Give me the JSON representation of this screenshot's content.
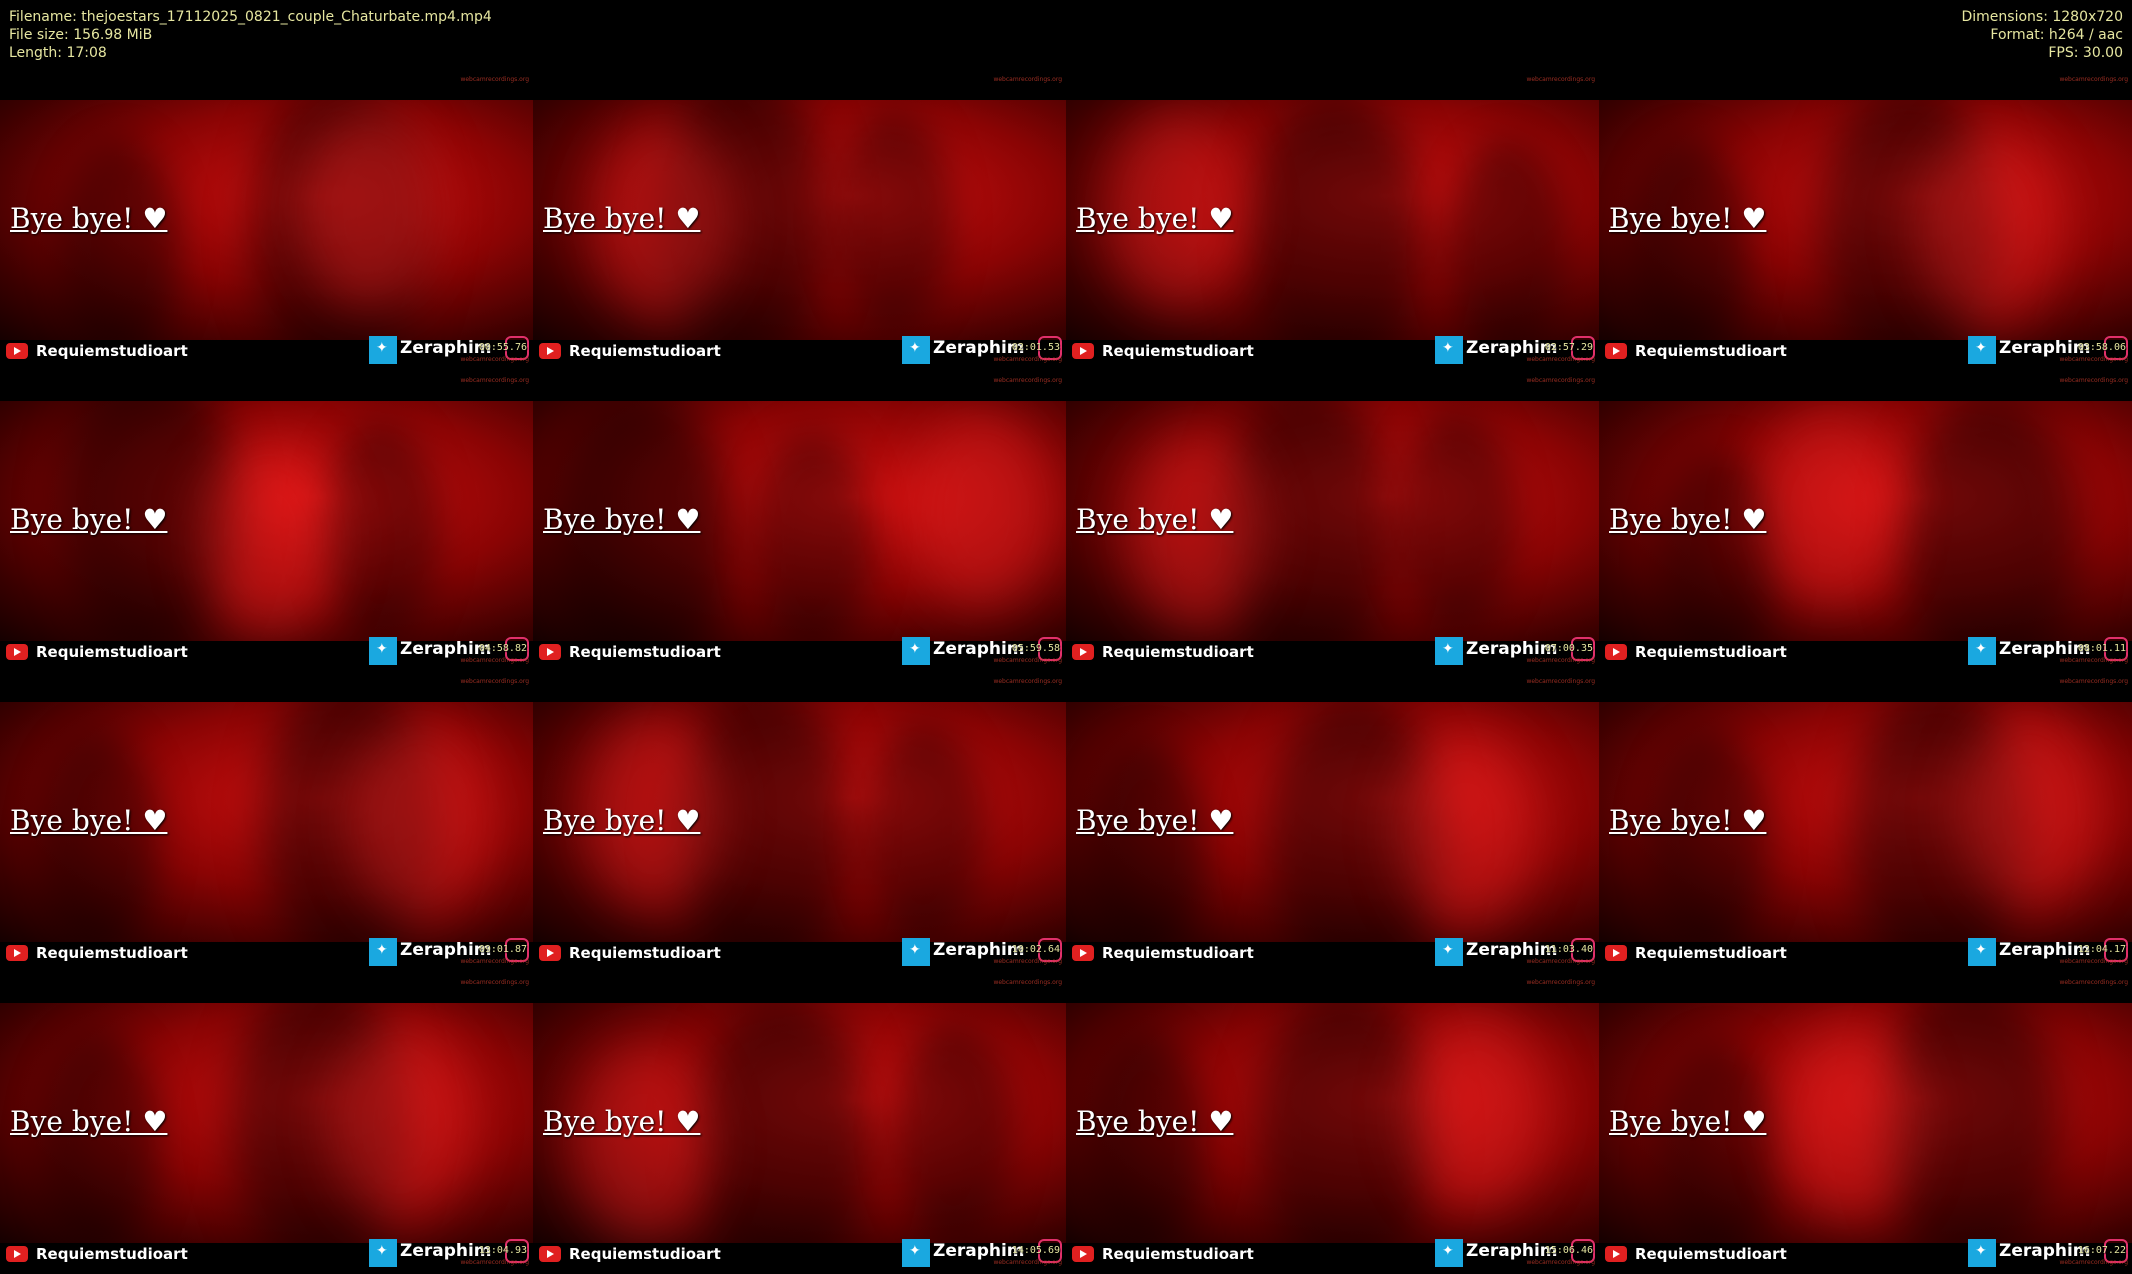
{
  "meta": {
    "filename": "Filename: thejoestars_17112025_0821_couple_Chaturbate.mp4.mp4",
    "filesize": "File size: 156.98 MiB",
    "length": "Length: 17:08",
    "dimensions": "Dimensions: 1280x720",
    "format": "Format: h264 / aac",
    "fps": "FPS: 30.00"
  },
  "overlay": {
    "caption": "Bye bye! ♥",
    "channel": "Requiemstudioart",
    "handle": "Zeraphim",
    "watermark": "webcamrecordings.org"
  },
  "thumbnails": [
    {
      "time": "00:55.76"
    },
    {
      "time": "02:01.53"
    },
    {
      "time": "02:57.29"
    },
    {
      "time": "03:58.06"
    },
    {
      "time": "04:58.82"
    },
    {
      "time": "05:59.58"
    },
    {
      "time": "07:00.35"
    },
    {
      "time": "08:01.11"
    },
    {
      "time": "09:01.87"
    },
    {
      "time": "10:02.64"
    },
    {
      "time": "11:03.40"
    },
    {
      "time": "12:04.17"
    },
    {
      "time": "13:04.93"
    },
    {
      "time": "14:05.69"
    },
    {
      "time": "15:06.46"
    },
    {
      "time": "16:07.22"
    }
  ]
}
